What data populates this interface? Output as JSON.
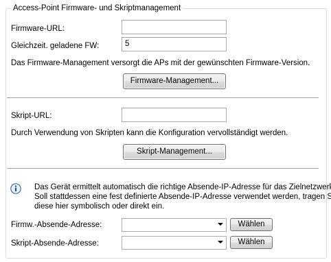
{
  "group": {
    "title": "Access-Point Firmware- und Skriptmanagement"
  },
  "firmware": {
    "url_label": "Firmware-URL:",
    "url_value": "",
    "parallel_label": "Gleichzeit. geladene FW:",
    "parallel_value": "5",
    "description": "Das Firmware-Management versorgt die APs mit der gewünschten Firmware-Version.",
    "button_label": "Firmware-Management..."
  },
  "script": {
    "url_label": "Skript-URL:",
    "url_value": "",
    "description": "Durch Verwendung von Skripten kann die Konfiguration vervollständigt werden.",
    "button_label": "Skript-Management..."
  },
  "info": {
    "icon": "info-icon",
    "line1": "Das Gerät ermittelt automatisch die richtige Absende-IP-Adresse für das Zielnetzwerk.",
    "line2": "Soll stattdessen eine fest definierte Absende-IP-Adresse verwendet werden, tragen Sie",
    "line3": "diese hier symbolisch oder direkt ein."
  },
  "source": {
    "firmware_label": "Firmw.-Absende-Adresse:",
    "firmware_value": "",
    "script_label": "Skript-Absende-Adresse:",
    "script_value": "",
    "choose_label": "Wählen"
  }
}
